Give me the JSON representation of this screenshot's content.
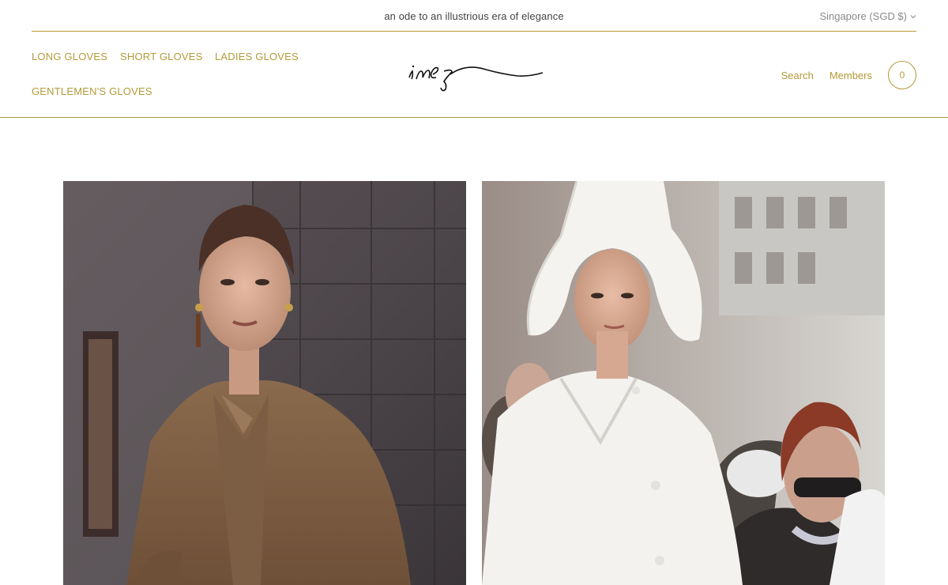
{
  "announcement": {
    "text": "an ode to an illustrious era of elegance"
  },
  "region": {
    "label": "Singapore (SGD $)"
  },
  "nav": {
    "items": [
      {
        "label": "LONG GLOVES"
      },
      {
        "label": "SHORT GLOVES"
      },
      {
        "label": "LADIES GLOVES"
      },
      {
        "label": "GENTLEMEN'S GLOVES"
      }
    ]
  },
  "brand": {
    "logo_text": "ines"
  },
  "header_actions": {
    "search_label": "Search",
    "members_label": "Members",
    "cart_count": "0"
  },
  "hero_images": [
    {
      "label": "Woman in camel blazer beside stone wall"
    },
    {
      "label": "Woman in white hat and white coat in crowd"
    }
  ],
  "colors": {
    "accent": "#b49a3a",
    "text": "#444444",
    "muted": "#8a8a8a",
    "background": "#ffffff"
  }
}
